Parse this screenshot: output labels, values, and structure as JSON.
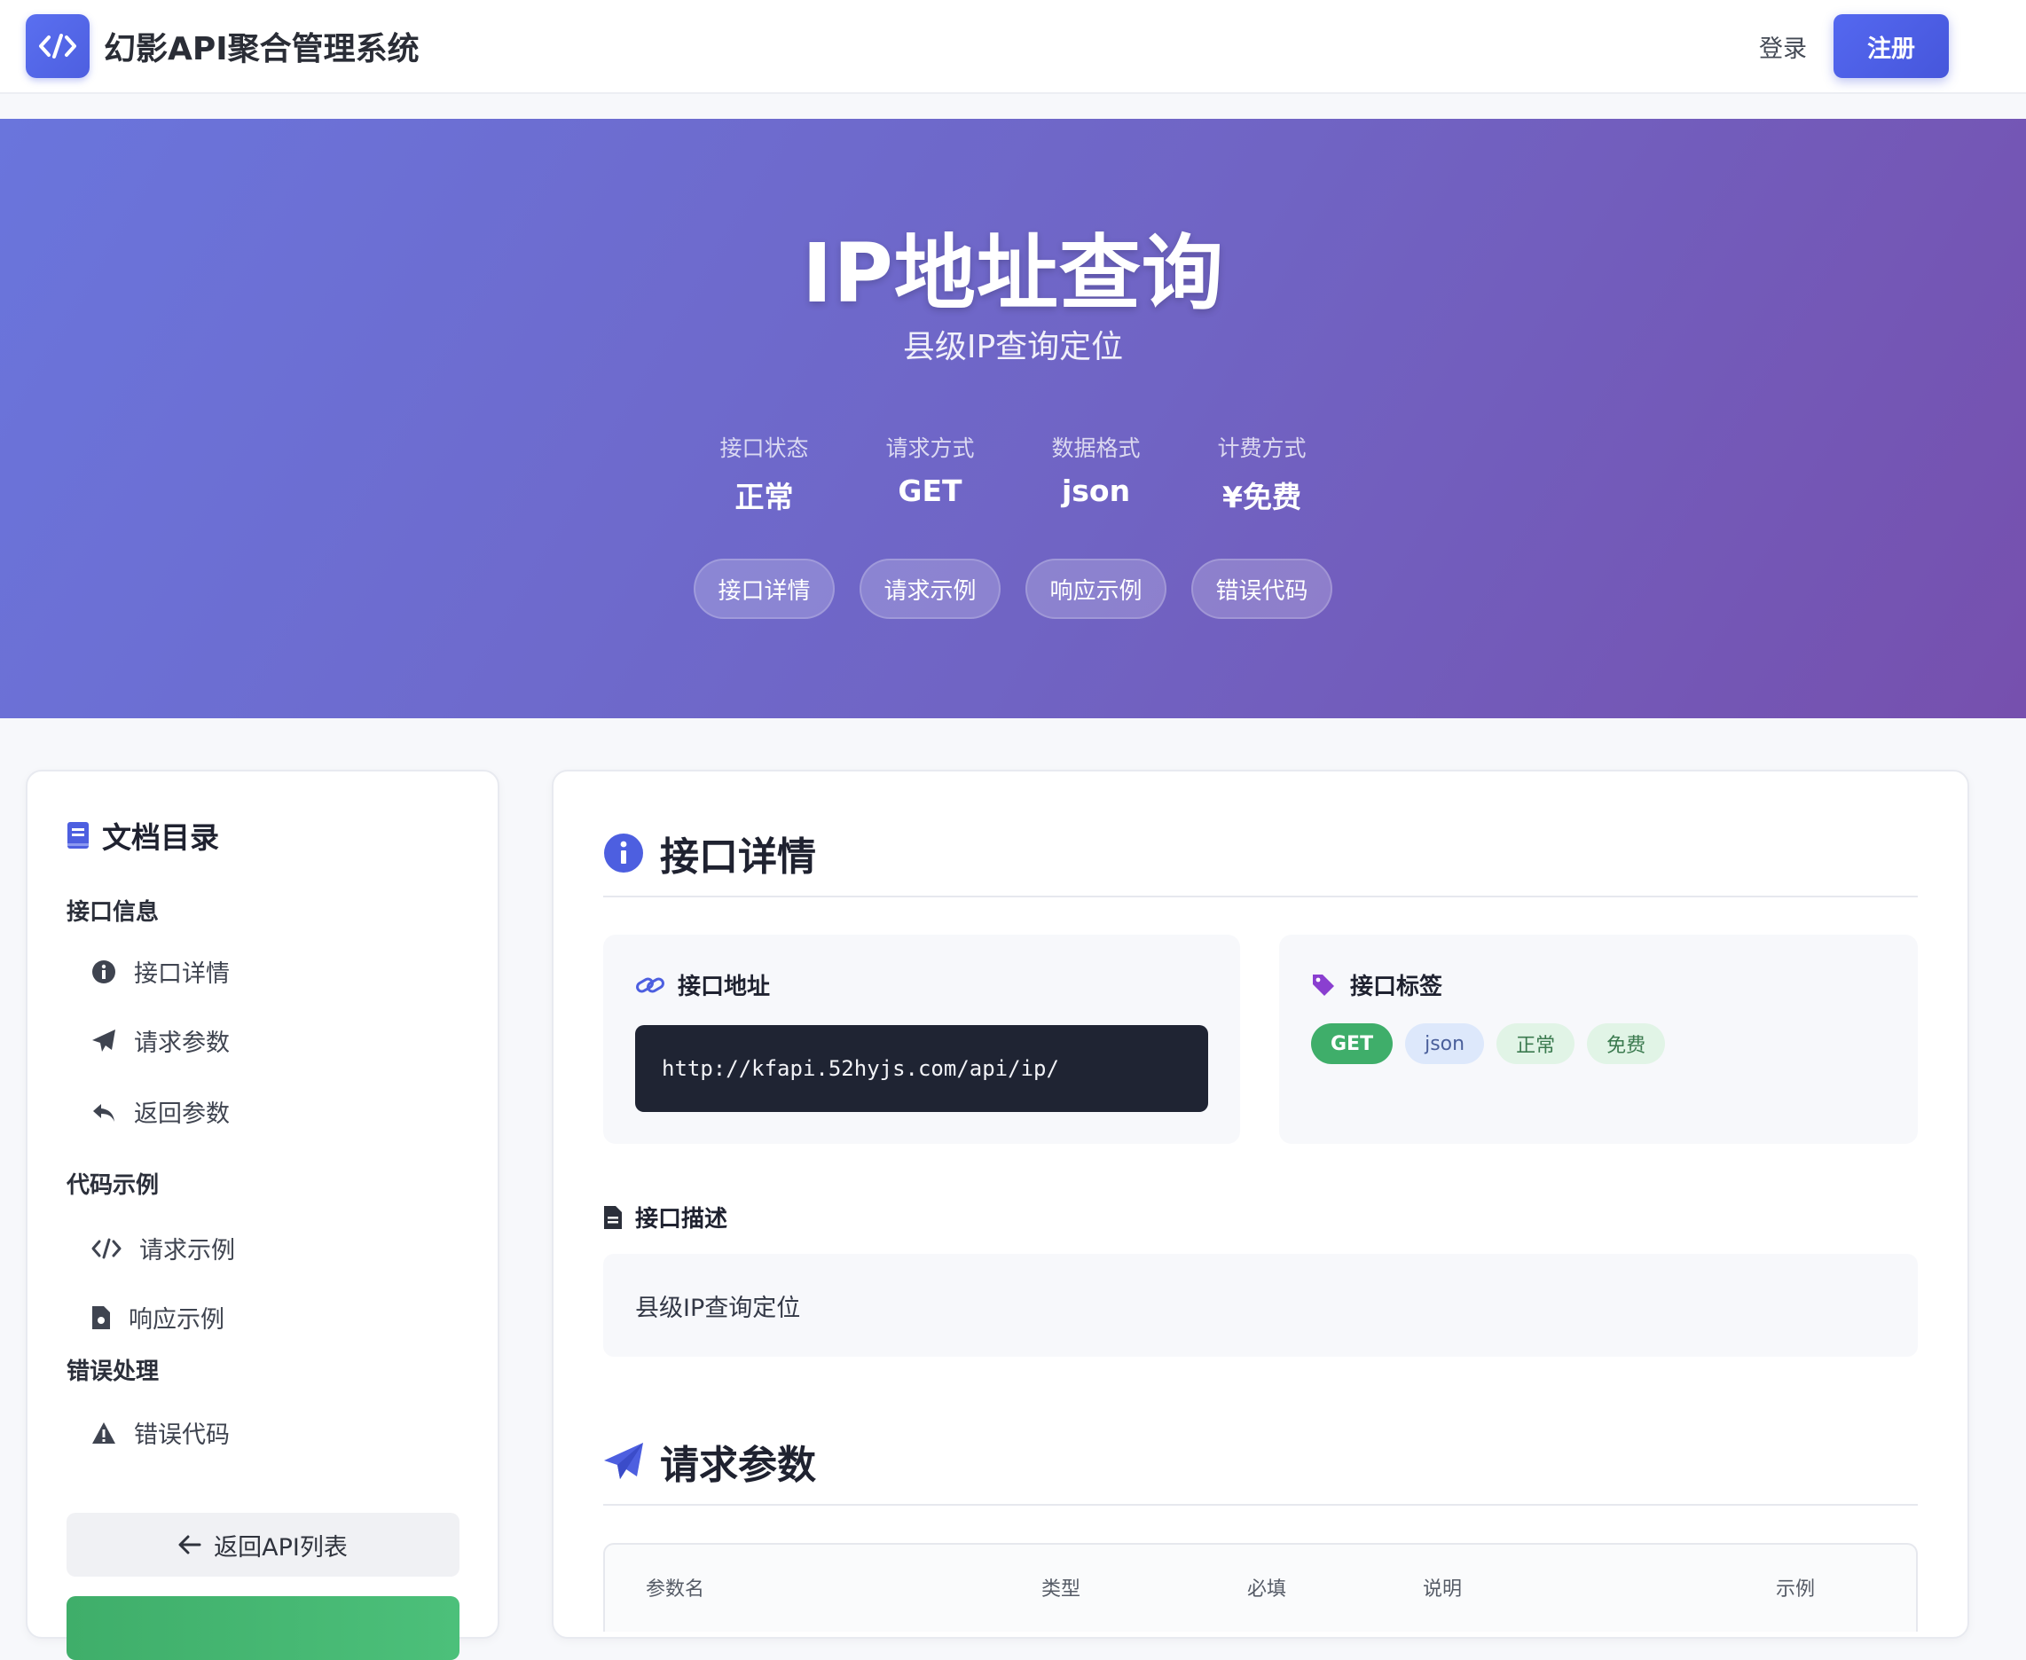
{
  "header": {
    "brand": "幻影API聚合管理系统",
    "login": "登录",
    "register": "注册"
  },
  "hero": {
    "title": "IP地址查询",
    "subtitle": "县级IP查询定位",
    "stats": [
      {
        "label": "接口状态",
        "value": "正常"
      },
      {
        "label": "请求方式",
        "value": "GET"
      },
      {
        "label": "数据格式",
        "value": "json"
      },
      {
        "label": "计费方式",
        "value": "¥免费"
      }
    ],
    "pills": [
      "接口详情",
      "请求示例",
      "响应示例",
      "错误代码"
    ]
  },
  "sidebar": {
    "title": "文档目录",
    "groups": [
      {
        "label": "接口信息",
        "items": [
          "接口详情",
          "请求参数",
          "返回参数"
        ]
      },
      {
        "label": "代码示例",
        "items": [
          "请求示例",
          "响应示例"
        ]
      },
      {
        "label": "错误处理",
        "items": [
          "错误代码"
        ]
      }
    ],
    "back_button": "返回API列表"
  },
  "main": {
    "detail_title": "接口详情",
    "url_card": {
      "title": "接口地址",
      "url": "http://kfapi.52hyjs.com/api/ip/"
    },
    "tags_card": {
      "title": "接口标签",
      "tags": [
        "GET",
        "json",
        "正常",
        "免费"
      ]
    },
    "description": {
      "title": "接口描述",
      "text": "县级IP查询定位"
    },
    "params_title": "请求参数",
    "params_table": {
      "columns": [
        "参数名",
        "类型",
        "必填",
        "说明",
        "示例"
      ]
    }
  },
  "colors": {
    "accent": "#4d5fe0",
    "hero_start": "#6a75dc",
    "hero_end": "#7650ae",
    "success": "#3fae6a",
    "code_bg": "#1f2433"
  }
}
